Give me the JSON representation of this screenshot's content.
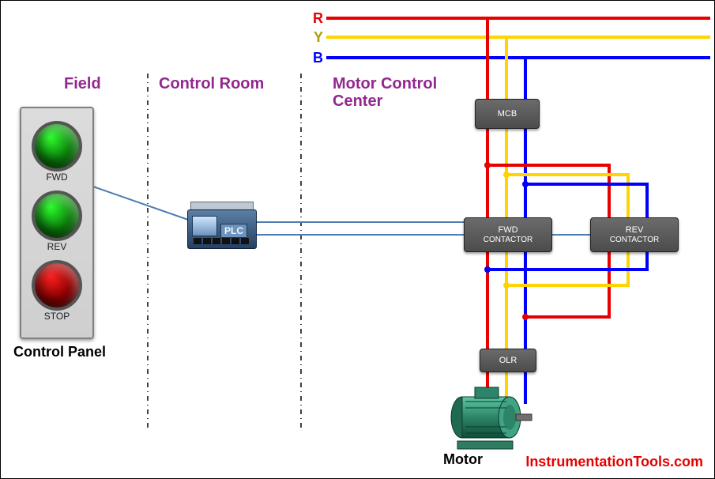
{
  "sections": {
    "field": "Field",
    "control_room": "Control Room",
    "mcc": "Motor Control\nCenter"
  },
  "branding": "InstrumentationTools.com",
  "control_panel": {
    "caption": "Control Panel",
    "buttons": {
      "fwd": "FWD",
      "rev": "REV",
      "stop": "STOP"
    }
  },
  "plc": {
    "label": "PLC"
  },
  "phases": {
    "r": "R",
    "y": "Y",
    "b": "B"
  },
  "blocks": {
    "mcb": "MCB",
    "fwd_contactor": {
      "l1": "FWD",
      "l2": "CONTACTOR"
    },
    "rev_contactor": {
      "l1": "REV",
      "l2": "CONTACTOR"
    },
    "olr": "OLR"
  },
  "motor": {
    "caption": "Motor"
  },
  "colors": {
    "r": "#e60000",
    "y": "#ffd400",
    "b": "#0000ff"
  }
}
